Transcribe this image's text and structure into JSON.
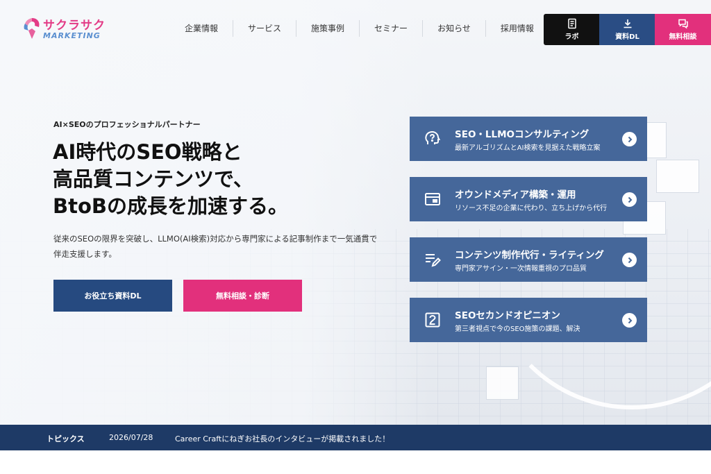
{
  "header": {
    "logo_jp": "サクラサク",
    "logo_en": "MARKETING",
    "nav": [
      {
        "label": "企業情報"
      },
      {
        "label": "サービス"
      },
      {
        "label": "施策事例"
      },
      {
        "label": "セミナー"
      },
      {
        "label": "お知らせ"
      },
      {
        "label": "採用情報"
      }
    ],
    "buttons": {
      "lab": "ラボ",
      "download": "資料DL",
      "consult": "無料相談"
    }
  },
  "hero": {
    "eyebrow": "AI×SEOのプロフェッショナルパートナー",
    "headline": [
      "AI時代のSEO戦略と",
      "高品質コンテンツで、",
      "BtoBの成長を加速する。"
    ],
    "lead": "従来のSEOの限界を突破し、LLMO(AI検索)対応から専門家による記事制作まで一気通貫で伴走支援します。",
    "cta_download": "お役立ち資料DL",
    "cta_consult": "無料相談・診断"
  },
  "services": [
    {
      "title": "SEO・LLMOコンサルティング",
      "subtitle": "最新アルゴリズムとAI検索を見据えた戦略立案",
      "icon": "head-question-icon"
    },
    {
      "title": "オウンドメディア構築・運用",
      "subtitle": "リソース不足の企業に代わり、立ち上げから代行",
      "icon": "browser-window-icon"
    },
    {
      "title": "コンテンツ制作代行・ライティング",
      "subtitle": "専門家アサイン・一次情報重視のプロ品質",
      "icon": "document-pen-icon"
    },
    {
      "title": "SEOセカンドオピニオン",
      "subtitle": "第三者視点で今のSEO施策の課題、解決",
      "icon": "number-two-icon"
    }
  ],
  "topics": {
    "label": "トピックス",
    "date": "2026/07/28",
    "text": "Career Craftにねぎお社長のインタビューが掲載されました！"
  },
  "colors": {
    "navy": "#264a80",
    "card": "#45679a",
    "pink": "#e2307c",
    "topics_bar": "#1e3a66"
  }
}
